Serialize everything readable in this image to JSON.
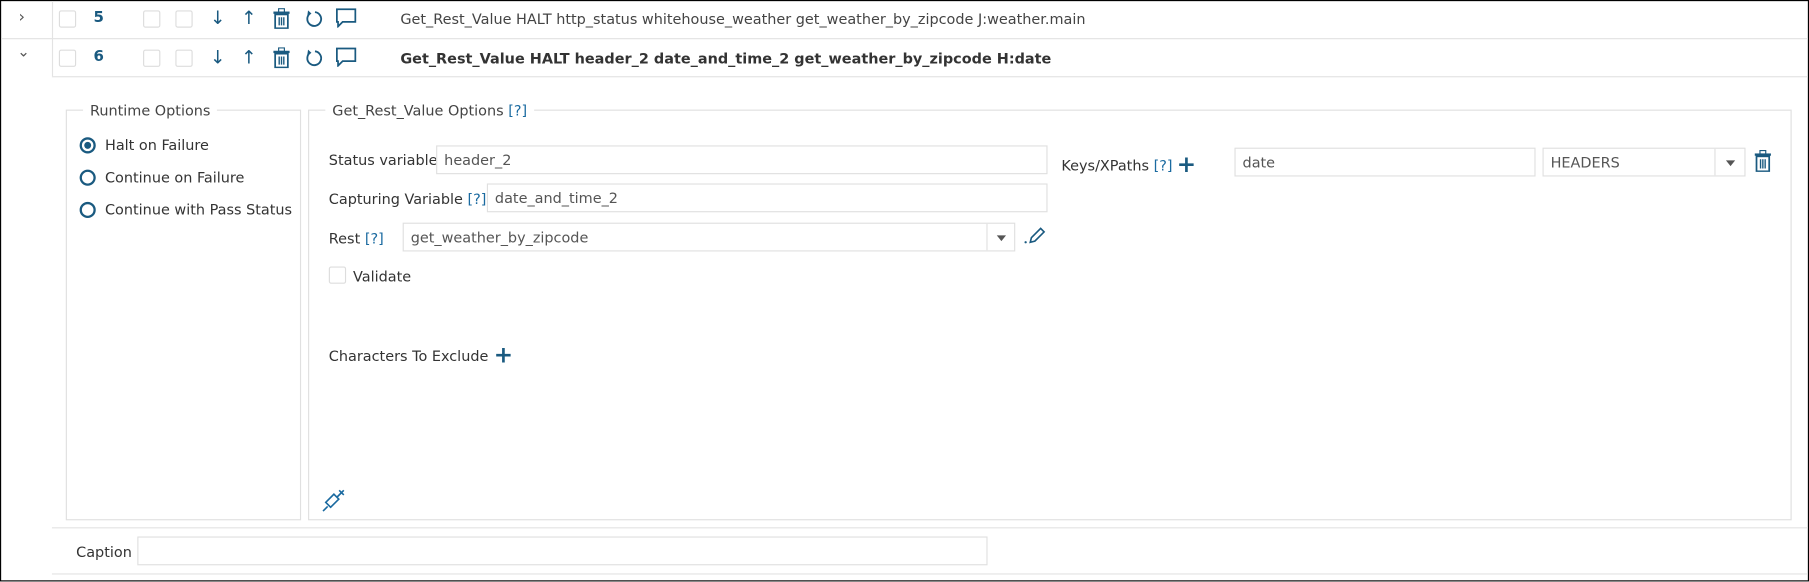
{
  "colors": {
    "accent": "#1a5a80",
    "border": "#e0e0e0"
  },
  "rows": [
    {
      "number": "5",
      "expanded": false,
      "text": "Get_Rest_Value HALT http_status whitehouse_weather get_weather_by_zipcode J:weather.main",
      "expand_icon": "chevron-right-icon"
    },
    {
      "number": "6",
      "expanded": true,
      "text": "Get_Rest_Value HALT header_2 date_and_time_2 get_weather_by_zipcode H:date",
      "expand_icon": "chevron-down-icon"
    }
  ],
  "row_icons": [
    "arrow-down-icon",
    "arrow-up-icon",
    "trash-icon",
    "refresh-icon",
    "comment-icon"
  ],
  "runtime": {
    "legend": "Runtime Options",
    "options": [
      {
        "label": "Halt on Failure",
        "selected": true
      },
      {
        "label": "Continue on Failure",
        "selected": false
      },
      {
        "label": "Continue with Pass Status",
        "selected": false
      }
    ]
  },
  "options": {
    "legend": "Get_Rest_Value Options",
    "help": "[?]",
    "status_label": "Status variable",
    "status_value": "header_2",
    "capturing_label": "Capturing Variable",
    "capturing_value": "date_and_time_2",
    "rest_label": "Rest",
    "rest_value": "get_weather_by_zipcode",
    "validate_label": "Validate",
    "validate_checked": false,
    "exclude_label": "Characters To Exclude",
    "keys_label": "Keys/XPaths",
    "key_value": "date",
    "key_type": "HEADERS"
  },
  "caption": {
    "label": "Caption",
    "value": ""
  }
}
